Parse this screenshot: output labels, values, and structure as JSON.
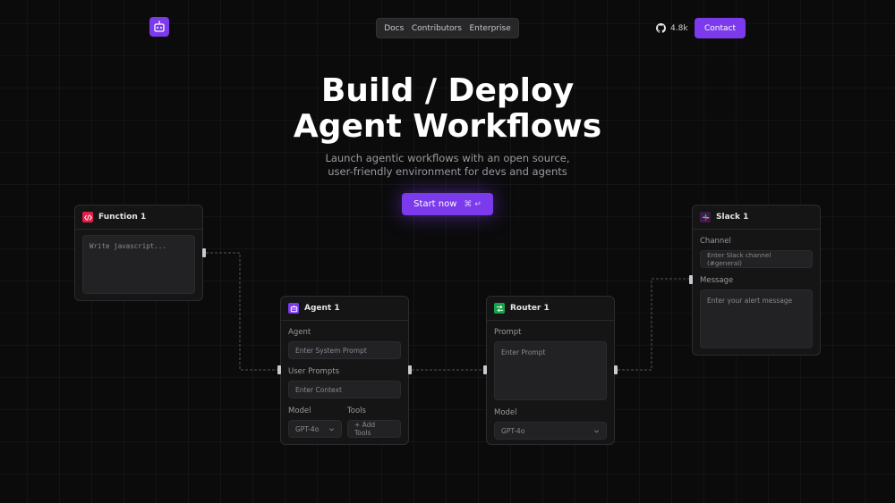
{
  "nav": {
    "logo_icon": "robot-icon",
    "links": [
      "Docs",
      "Contributors",
      "Enterprise"
    ],
    "github_stars": "4.8k",
    "contact_label": "Contact"
  },
  "hero": {
    "title_line1": "Build / Deploy",
    "title_line2": "Agent Workflows",
    "subtitle_line1": "Launch agentic workflows with an open source,",
    "subtitle_line2": "user-friendly environment for devs and agents",
    "cta_label": "Start now",
    "cta_shortcut": "⌘ ↵"
  },
  "nodes": {
    "function": {
      "title": "Function 1",
      "code_placeholder": "Write javascript..."
    },
    "agent": {
      "title": "Agent 1",
      "agent_label": "Agent",
      "agent_placeholder": "Enter System Prompt",
      "user_prompts_label": "User Prompts",
      "context_placeholder": "Enter Context",
      "model_label": "Model",
      "model_value": "GPT-4o",
      "tools_label": "Tools",
      "add_tools_label": "+ Add Tools"
    },
    "router": {
      "title": "Router 1",
      "prompt_label": "Prompt",
      "prompt_placeholder": "Enter Prompt",
      "model_label": "Model",
      "model_value": "GPT-4o"
    },
    "slack": {
      "title": "Slack 1",
      "channel_label": "Channel",
      "channel_placeholder": "Enter Slack channel (#general)",
      "message_label": "Message",
      "message_placeholder": "Enter your alert message"
    }
  },
  "colors": {
    "accent": "#7c3aed",
    "function_badge": "#e11d48",
    "router_badge": "#16a34a",
    "slack_badge": "#3b1d4a"
  }
}
